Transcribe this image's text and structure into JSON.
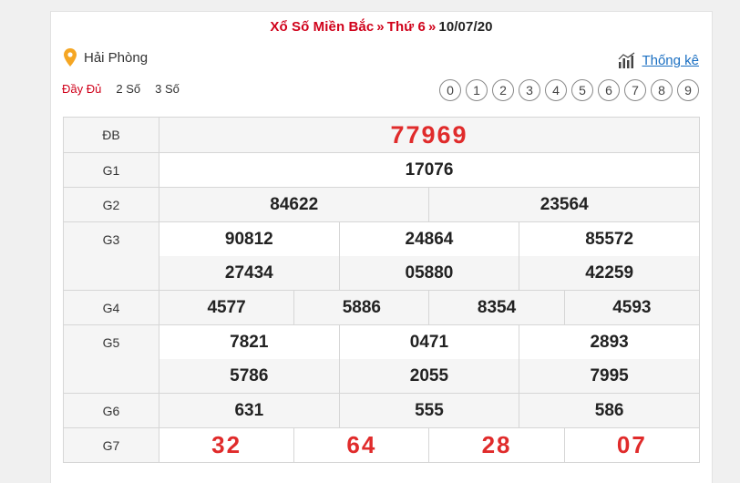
{
  "header": {
    "title_part1": "Xổ Số Miền Bắc",
    "separator": "»",
    "title_part2": "Thứ 6",
    "date": "10/07/20"
  },
  "location": {
    "name": "Hải Phòng",
    "icon": "location-pin-icon"
  },
  "stats_link": {
    "label": "Thống kê",
    "icon": "bar-chart-icon"
  },
  "tabs": [
    {
      "label": "Đầy Đủ",
      "active": true
    },
    {
      "label": "2 Số",
      "active": false
    },
    {
      "label": "3 Số",
      "active": false
    }
  ],
  "digits": [
    "0",
    "1",
    "2",
    "3",
    "4",
    "5",
    "6",
    "7",
    "8",
    "9"
  ],
  "results": {
    "db": {
      "label": "ĐB",
      "values": [
        "77969"
      ]
    },
    "g1": {
      "label": "G1",
      "values": [
        "17076"
      ]
    },
    "g2": {
      "label": "G2",
      "values": [
        "84622",
        "23564"
      ]
    },
    "g3": {
      "label": "G3",
      "values": [
        "90812",
        "24864",
        "85572",
        "27434",
        "05880",
        "42259"
      ]
    },
    "g4": {
      "label": "G4",
      "values": [
        "4577",
        "5886",
        "8354",
        "4593"
      ]
    },
    "g5": {
      "label": "G5",
      "values": [
        "7821",
        "0471",
        "2893",
        "5786",
        "2055",
        "7995"
      ]
    },
    "g6": {
      "label": "G6",
      "values": [
        "631",
        "555",
        "586"
      ]
    },
    "g7": {
      "label": "G7",
      "values": [
        "32",
        "64",
        "28",
        "07"
      ]
    }
  },
  "colors": {
    "accent_red": "#d0021b",
    "number_red": "#e02b2b",
    "link_blue": "#1a6fc2",
    "pin_orange": "#f5a623"
  }
}
